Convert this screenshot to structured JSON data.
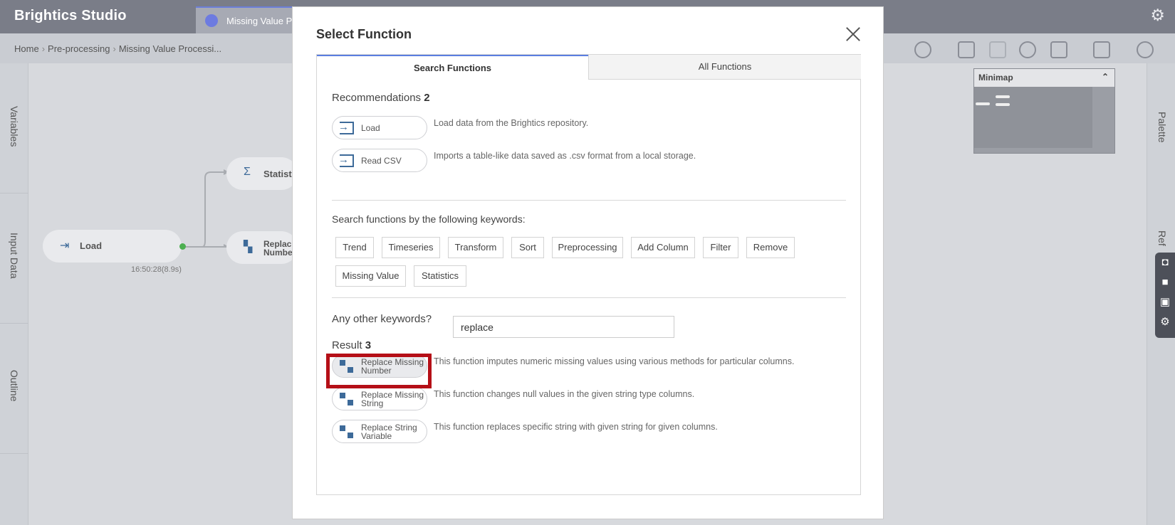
{
  "app": {
    "title": "Brightics Studio",
    "doc_tab": "Missing Value Pr"
  },
  "breadcrumb": {
    "home": "Home",
    "section": "Pre-processing",
    "page": "Missing Value Processi..."
  },
  "left_tabs": [
    "Variables",
    "Input Data",
    "Outline"
  ],
  "right_tabs": [
    "Palette",
    "Ref"
  ],
  "canvas": {
    "nodes": [
      {
        "label": "Load",
        "icon": "load-arrow-icon"
      },
      {
        "label": "Statisti",
        "icon": "sigma-icon"
      },
      {
        "label": "Replac Numbe",
        "icon": "replace-blocks-icon"
      }
    ],
    "load_time": "16:50:28(8.9s)",
    "minimap_title": "Minimap"
  },
  "modal": {
    "title": "Select Function",
    "tabs": {
      "active": "Search Functions",
      "inactive": "All Functions"
    },
    "recommendations": {
      "label": "Recommendations",
      "count": "2",
      "items": [
        {
          "name": "Load",
          "desc": "Load data from the Brightics repository."
        },
        {
          "name": "Read CSV",
          "desc": "Imports a table-like data saved as .csv format from a local storage."
        }
      ]
    },
    "keywords": {
      "label": "Search functions by the following keywords:",
      "items": [
        "Trend",
        "Timeseries",
        "Transform",
        "Sort",
        "Preprocessing",
        "Add Column",
        "Filter",
        "Remove",
        "Missing Value",
        "Statistics"
      ]
    },
    "other": {
      "label": "Any other keywords?",
      "value": "replace"
    },
    "result": {
      "label": "Result",
      "count": "3",
      "items": [
        {
          "name_line1": "Replace Missing",
          "name_line2": "Number",
          "desc": "This function imputes numeric missing values using various methods for particular columns."
        },
        {
          "name_line1": "Replace Missing",
          "name_line2": "String",
          "desc": "This function changes null values in the given string type columns."
        },
        {
          "name_line1": "Replace String",
          "name_line2": "Variable",
          "desc": "This function replaces specific string with given string for given columns."
        }
      ]
    }
  },
  "colors": {
    "accent": "#5a7ee0",
    "highlight": "#b50f17",
    "icon": "#3d6a99"
  }
}
